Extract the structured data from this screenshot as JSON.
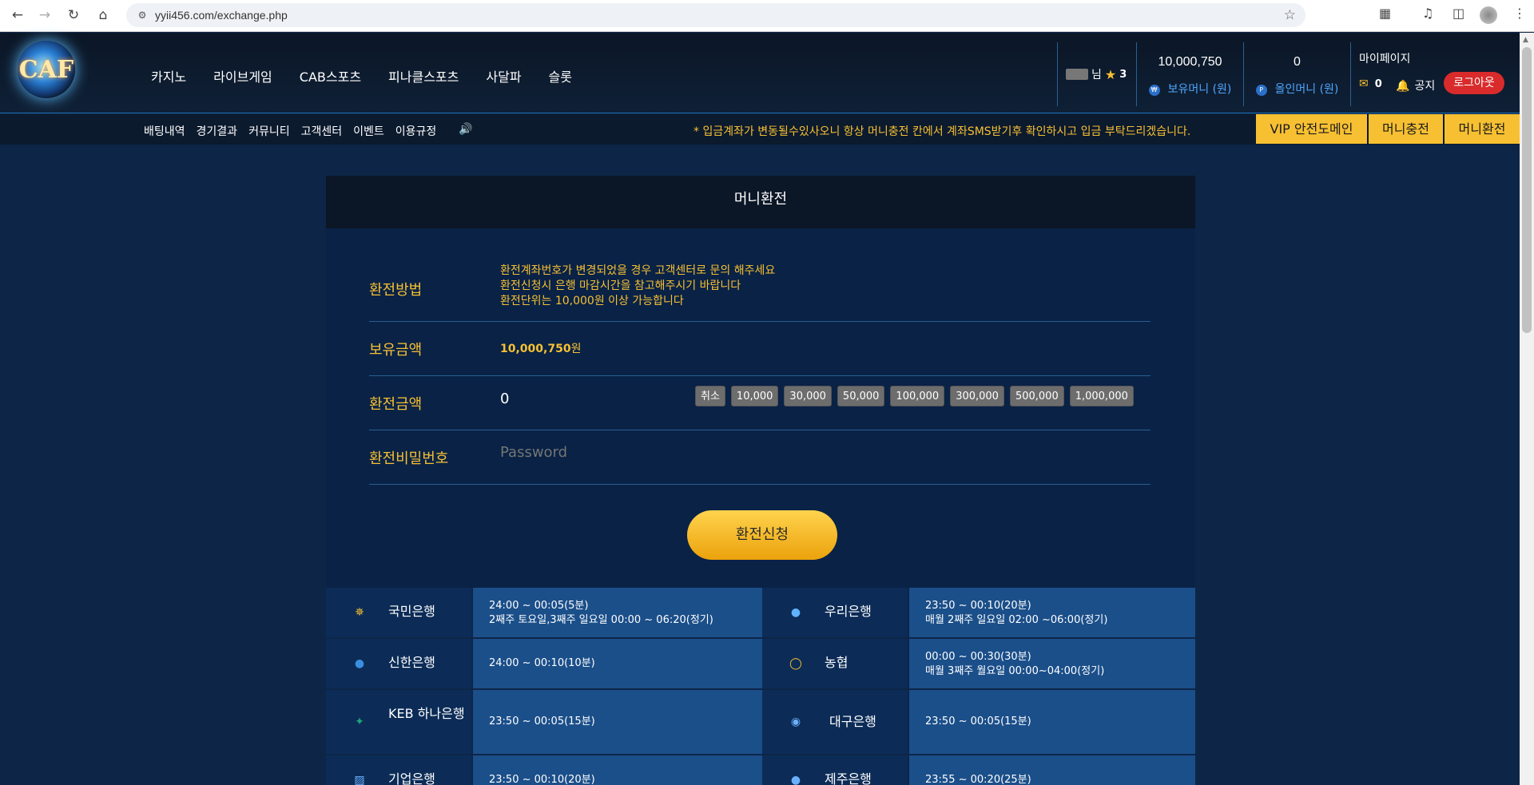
{
  "browser": {
    "url": "yyii456.com/exchange.php"
  },
  "header": {
    "logo_text": "CAF",
    "nav": [
      "카지노",
      "라이브게임",
      "CAB스포츠",
      "피나클스포츠",
      "사달파",
      "슬롯"
    ],
    "user_suffix": "님",
    "level": "3",
    "money_value": "10,000,750",
    "money_label": "보유머니 (원)",
    "point_value": "0",
    "point_label": "올인머니 (원)",
    "mypage": "마이페이지",
    "mail_count": "0",
    "notice": "공지",
    "logout": "로그아웃"
  },
  "subnav": {
    "links": [
      "배팅내역",
      "경기결과",
      "커뮤니티",
      "고객센터",
      "이벤트",
      "이용규정"
    ],
    "marquee": "* 입금계좌가 변동될수있사오니 항상 머니충전 칸에서 계좌SMS받기후 확인하시고 입금 부탁드리겠습니다.",
    "buttons": [
      "VIP 안전도메인",
      "머니충전",
      "머니환전"
    ]
  },
  "exchange": {
    "title": "머니환전",
    "method_label": "환전방법",
    "method_lines": [
      "환전계좌번호가 변경되었을 경우 고객센터로 문의 해주세요",
      "환전신청시 은행 마감시간을 참고해주시기 바랍니다",
      "환전단위는 10,000원 이상 가능합니다"
    ],
    "balance_label": "보유금액",
    "balance_value": "10,000,750",
    "balance_unit": "원",
    "amount_label": "환전금액",
    "amount_value": "0",
    "chips": [
      "취소",
      "10,000",
      "30,000",
      "50,000",
      "100,000",
      "300,000",
      "500,000",
      "1,000,000"
    ],
    "password_label": "환전비밀번호",
    "password_placeholder": "Password",
    "submit": "환전신청"
  },
  "banks": [
    {
      "left": {
        "name": "국민은행",
        "icon": "kb-icon",
        "line1": "24:00 ~ 00:05(5분)",
        "line2": "2째주 토요일,3째주 일요일 00:00 ~ 06:20(정기)"
      },
      "right": {
        "name": "우리은행",
        "icon": "woori-icon",
        "line1": "23:50 ~ 00:10(20분)",
        "line2": "매월 2째주 일요일 02:00 ~06:00(정기)"
      }
    },
    {
      "left": {
        "name": "신한은행",
        "icon": "shinhan-icon",
        "line1": "24:00 ~ 00:10(10분)",
        "line2": ""
      },
      "right": {
        "name": "농협",
        "icon": "nh-icon",
        "line1": "00:00 ~ 00:30(30분)",
        "line2": "매월 3째주 월요일 00:00~04:00(정기)"
      }
    },
    {
      "left": {
        "name": "KEB 하나은행",
        "icon": "hana-icon",
        "line1": "23:50 ~ 00:05(15분)",
        "line2": ""
      },
      "right": {
        "name": "대구은행",
        "icon": "dgb-icon",
        "line1": "23:50 ~ 00:05(15분)",
        "line2": ""
      }
    },
    {
      "left": {
        "name": "기업은행",
        "icon": "ibk-icon",
        "line1": "23:50 ~ 00:10(20분)",
        "line2": ""
      },
      "right": {
        "name": "제주은행",
        "icon": "jeju-icon",
        "line1": "23:55 ~ 00:20(25분)",
        "line2": ""
      }
    }
  ],
  "colors": {
    "accent": "#f7c032",
    "background": "#0d2547",
    "logout": "#d92b2b",
    "link_blue": "#4ea7ff"
  }
}
